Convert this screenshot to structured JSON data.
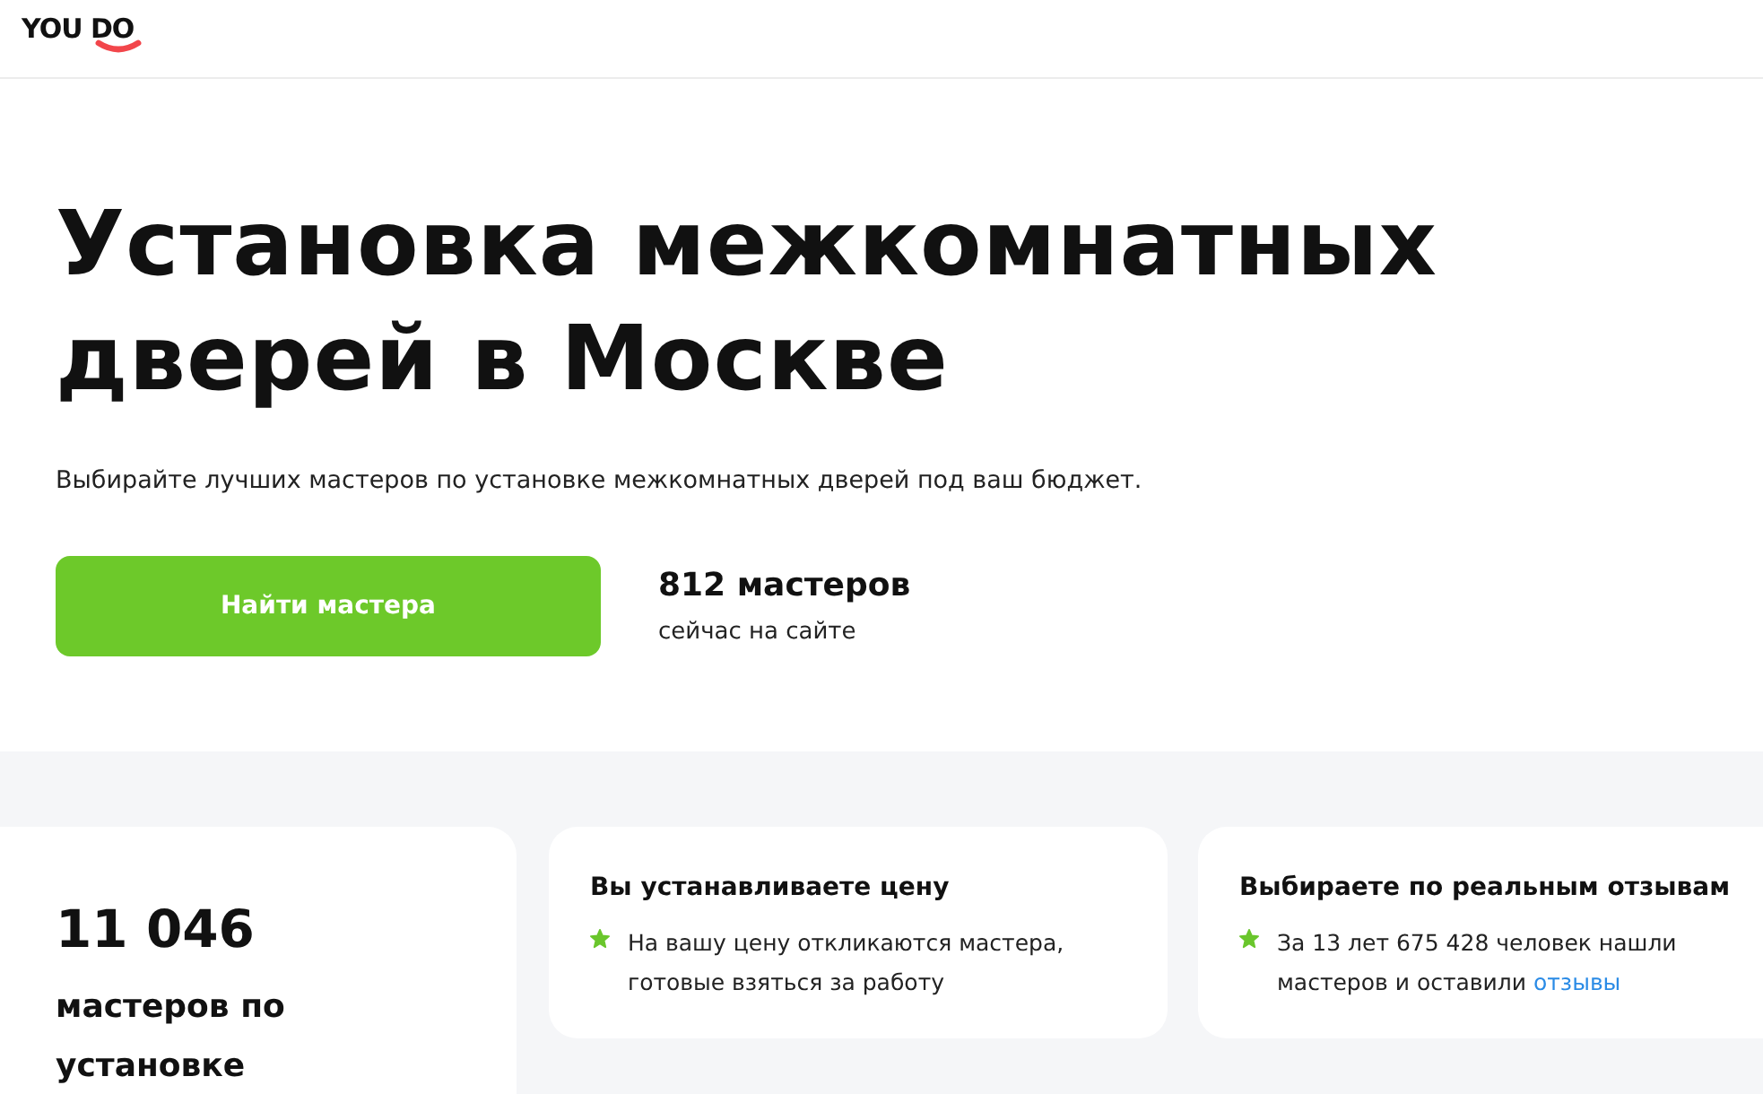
{
  "header": {
    "logo": "YOU DO"
  },
  "hero": {
    "title": "Установка межкомнатных дверей в Москве",
    "subtitle": "Выбирайте лучших мастеров по установке межкомнатных дверей под ваш бюджет.",
    "button": "Найти мастера",
    "count": "812 мастеров",
    "count_note": "сейчас на сайте"
  },
  "stat": {
    "number": "11 046",
    "label": "мастеров по установке"
  },
  "features": [
    {
      "title": "Вы устанавливаете цену",
      "text": "На вашу цену откликаются мастера, готовые взяться за работу"
    },
    {
      "title": "Выбираете по реальным отзывам",
      "text": "За 13 лет 675 428 человек нашли мастеров и оставили ",
      "link": "отзывы"
    }
  ]
}
